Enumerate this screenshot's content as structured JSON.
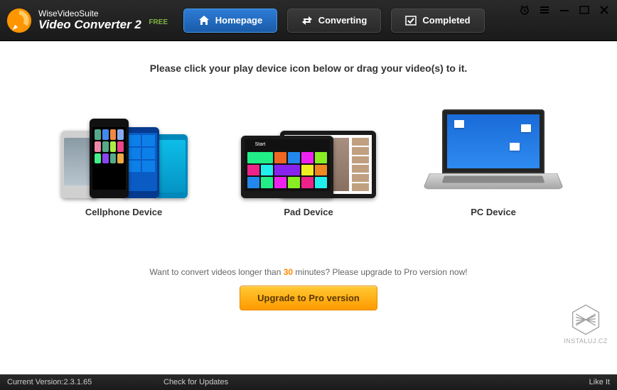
{
  "header": {
    "suite_name": "WiseVideoSuite",
    "product_name": "Video Converter 2",
    "free_badge": "FREE"
  },
  "tabs": [
    {
      "label": "Homepage",
      "active": true
    },
    {
      "label": "Converting",
      "active": false
    },
    {
      "label": "Completed",
      "active": false
    }
  ],
  "main": {
    "instruction": "Please click your play device icon below or drag your video(s) to it.",
    "devices": [
      {
        "label": "Cellphone Device"
      },
      {
        "label": "Pad Device"
      },
      {
        "label": "PC Device"
      }
    ],
    "upgrade_prefix": "Want to convert videos longer than ",
    "upgrade_highlight": "30",
    "upgrade_suffix": " minutes? Please upgrade to Pro version now!",
    "upgrade_button": "Upgrade to Pro version"
  },
  "footer": {
    "version_label": "Current Version:",
    "version_value": "2.3.1.65",
    "check_updates": "Check for Updates",
    "like_it": "Like It"
  },
  "watermark": "INSTALUJ.CZ"
}
